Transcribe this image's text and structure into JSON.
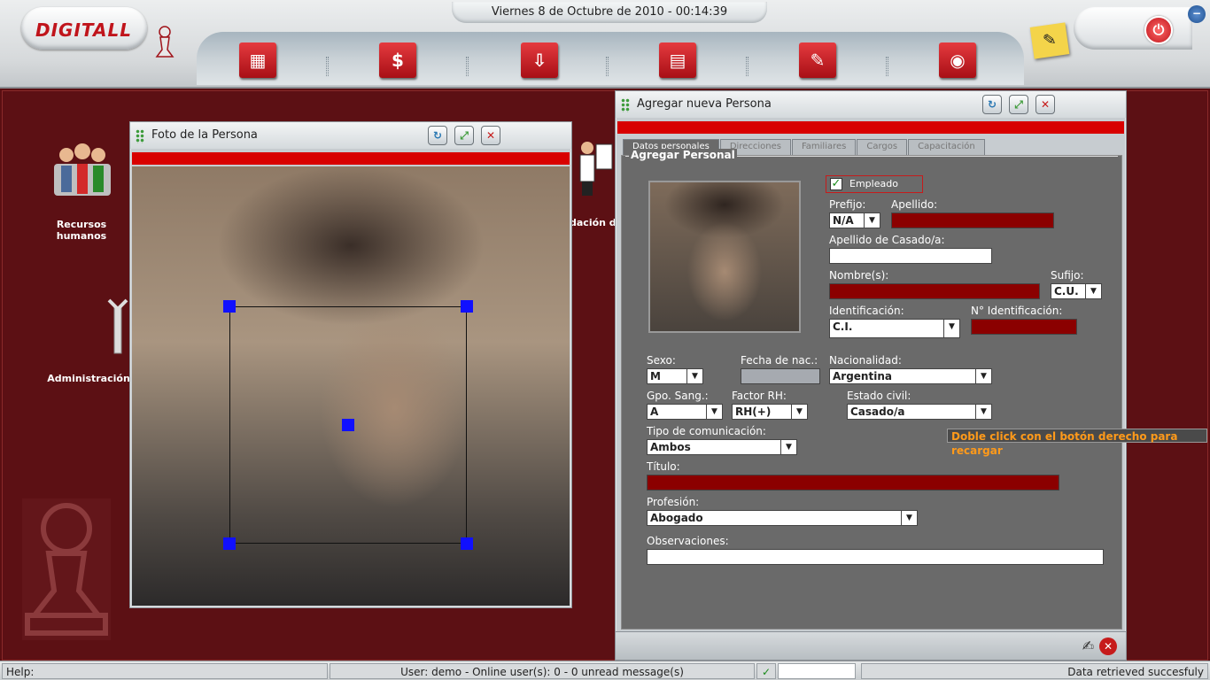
{
  "header": {
    "logo_text": "DIGITALL",
    "datetime": "Viernes 8 de Octubre de 2010 - 00:14:39",
    "nav_icons": [
      "calculator-icon",
      "money-icon",
      "download-icon",
      "org-chart-icon",
      "document-icon",
      "pin-icon"
    ]
  },
  "desktop": {
    "icons": [
      {
        "label": "Recursos\nhumanos"
      },
      {
        "label": "Administración"
      },
      {
        "label": "dación d"
      }
    ]
  },
  "photo_window": {
    "title": "Foto de la Persona"
  },
  "person_window": {
    "title": "Agregar nueva Persona",
    "tabs": [
      "Datos personales",
      "Direcciones",
      "Familiares",
      "Cargos",
      "Capacitación"
    ],
    "group_title": "Agregar Personal",
    "empleado_label": "Empleado",
    "labels": {
      "prefijo": "Prefijo:",
      "apellido": "Apellido:",
      "apellido_casado": "Apellido de Casado/a:",
      "nombres": "Nombre(s):",
      "sufijo": "Sufijo:",
      "identificacion": "Identificación:",
      "nro_identificacion": "N° Identificación:",
      "sexo": "Sexo:",
      "fecha_nac": "Fecha de nac.:",
      "nacionalidad": "Nacionalidad:",
      "gpo_sang": "Gpo. Sang.:",
      "factor_rh": "Factor RH:",
      "estado_civil": "Estado civil:",
      "tipo_comunicacion": "Tipo de comunicación:",
      "titulo": "Título:",
      "profesion": "Profesión:",
      "observaciones": "Observaciones:"
    },
    "values": {
      "prefijo": "N/A",
      "sufijo": "C.U.",
      "identificacion": "C.I.",
      "sexo": "M",
      "nacionalidad": "Argentina",
      "gpo_sang": "A",
      "factor_rh": "RH(+)",
      "estado_civil": "Casado/a",
      "tipo_comunicacion": "Ambos",
      "profesion": "Abogado"
    },
    "tooltip": "Doble click con el botón derecho para recargar"
  },
  "statusbar": {
    "help": "Help:",
    "user_info": "User: demo - Online user(s): 0 - 0 unread message(s)",
    "status": "Data retrieved succesfuly"
  },
  "colors": {
    "desktop_bg": "#5c1014",
    "required_field": "#8b0000",
    "accent_red": "#d80000",
    "tooltip_text": "#ff9a1a"
  }
}
